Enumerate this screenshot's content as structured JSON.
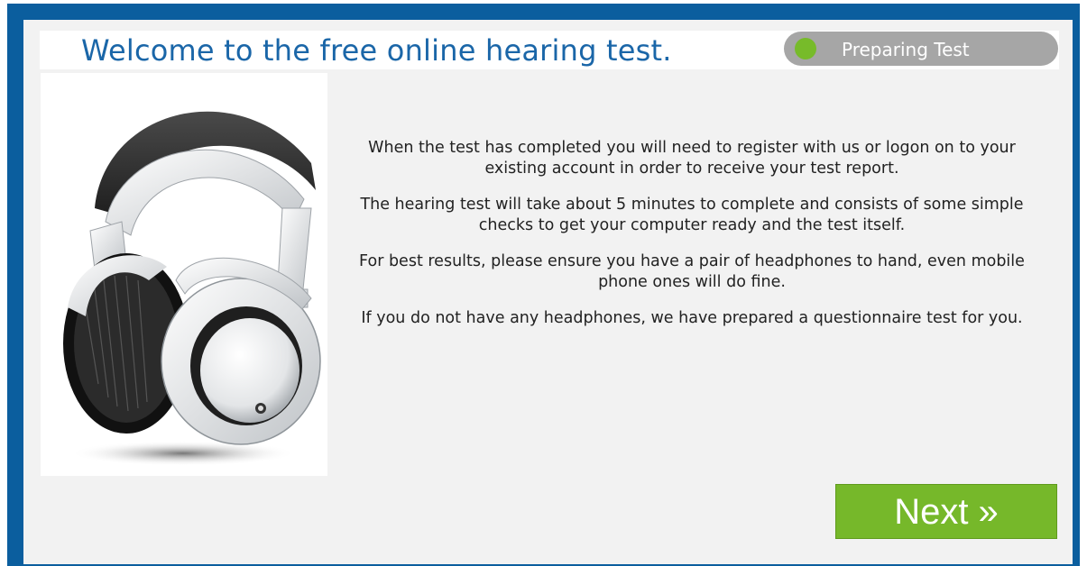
{
  "header": {
    "title": "Welcome to the free online hearing test.",
    "status_label": "Preparing Test",
    "status_color": "#77bb2a"
  },
  "illustration": {
    "icon": "headphones-icon"
  },
  "intro_paragraphs": [
    "When the test has completed you will need to register with us or logon on to your existing account in order to receive your test report.",
    "The hearing test will take about 5 minutes to complete and consists of some simple checks to get your computer ready and the test itself.",
    "For best results, please ensure you have a pair of headphones to hand, even mobile phone ones will do fine.",
    "If you do not have any headphones, we have prepared a questionnaire test for you."
  ],
  "actions": {
    "next_label": "Next »",
    "next_color": "#76b82a"
  },
  "colors": {
    "frame": "#0b5e9e",
    "panel": "#f2f2f2",
    "title": "#1a66a8"
  }
}
